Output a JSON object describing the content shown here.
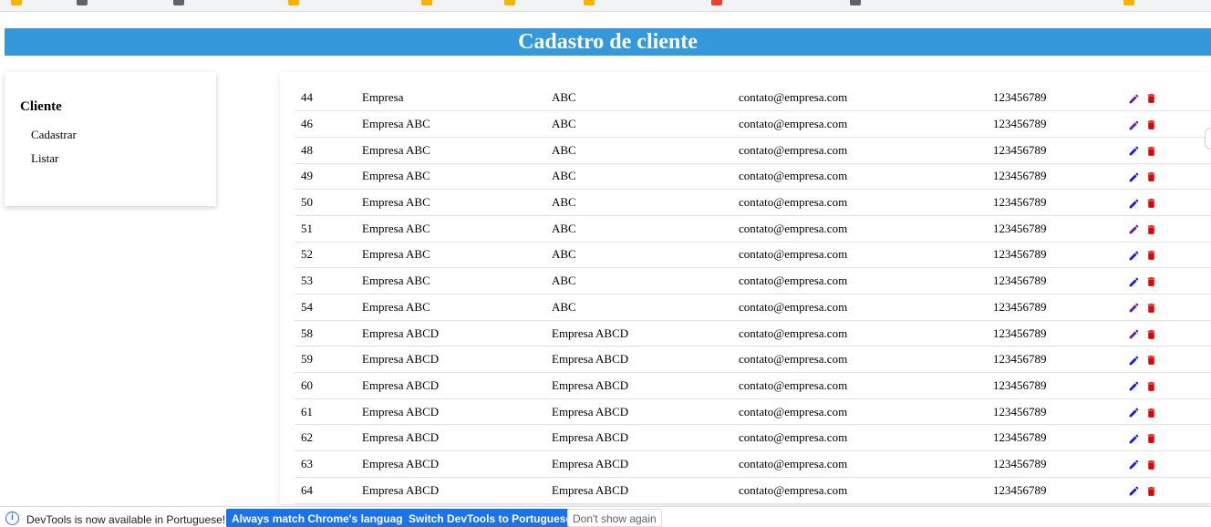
{
  "header": {
    "title": "Cadastro de cliente"
  },
  "sidebar": {
    "title": "Cliente",
    "links": [
      "Cadastrar",
      "Listar"
    ]
  },
  "colors": {
    "header_bg": "#3498db",
    "edit_icon_default": "#1a1adb",
    "edit_icon_visited": "#6a1b9a",
    "delete_icon": "#e60000"
  },
  "clients": [
    {
      "id": "44",
      "name": "Empresa",
      "alias": "ABC",
      "email": "contato@empresa.com",
      "phone": "123456789"
    },
    {
      "id": "46",
      "name": "Empresa ABC",
      "alias": "ABC",
      "email": "contato@empresa.com",
      "phone": "123456789"
    },
    {
      "id": "48",
      "name": "Empresa ABC",
      "alias": "ABC",
      "email": "contato@empresa.com",
      "phone": "123456789"
    },
    {
      "id": "49",
      "name": "Empresa ABC",
      "alias": "ABC",
      "email": "contato@empresa.com",
      "phone": "123456789"
    },
    {
      "id": "50",
      "name": "Empresa ABC",
      "alias": "ABC",
      "email": "contato@empresa.com",
      "phone": "123456789"
    },
    {
      "id": "51",
      "name": "Empresa ABC",
      "alias": "ABC",
      "email": "contato@empresa.com",
      "phone": "123456789"
    },
    {
      "id": "52",
      "name": "Empresa ABC",
      "alias": "ABC",
      "email": "contato@empresa.com",
      "phone": "123456789"
    },
    {
      "id": "53",
      "name": "Empresa ABC",
      "alias": "ABC",
      "email": "contato@empresa.com",
      "phone": "123456789"
    },
    {
      "id": "54",
      "name": "Empresa ABC",
      "alias": "ABC",
      "email": "contato@empresa.com",
      "phone": "123456789"
    },
    {
      "id": "58",
      "name": "Empresa ABCD",
      "alias": "Empresa ABCD",
      "email": "contato@empresa.com",
      "phone": "123456789"
    },
    {
      "id": "59",
      "name": "Empresa ABCD",
      "alias": "Empresa ABCD",
      "email": "contato@empresa.com",
      "phone": "123456789"
    },
    {
      "id": "60",
      "name": "Empresa ABCD",
      "alias": "Empresa ABCD",
      "email": "contato@empresa.com",
      "phone": "123456789"
    },
    {
      "id": "61",
      "name": "Empresa ABCD",
      "alias": "Empresa ABCD",
      "email": "contato@empresa.com",
      "phone": "123456789"
    },
    {
      "id": "62",
      "name": "Empresa ABCD",
      "alias": "Empresa ABCD",
      "email": "contato@empresa.com",
      "phone": "123456789"
    },
    {
      "id": "63",
      "name": "Empresa ABCD",
      "alias": "Empresa ABCD",
      "email": "contato@empresa.com",
      "phone": "123456789"
    },
    {
      "id": "64",
      "name": "Empresa ABCD",
      "alias": "Empresa ABCD",
      "email": "contato@empresa.com",
      "phone": "123456789"
    }
  ],
  "visited_edit_rows": [
    "44",
    "46",
    "51",
    "54",
    "58"
  ],
  "devtools_infobar": {
    "message": "DevTools is now available in Portuguese!",
    "match_button": "Always match Chrome's language",
    "switch_button": "Switch DevTools to Portuguese",
    "dismiss_button": "Don't show again"
  }
}
